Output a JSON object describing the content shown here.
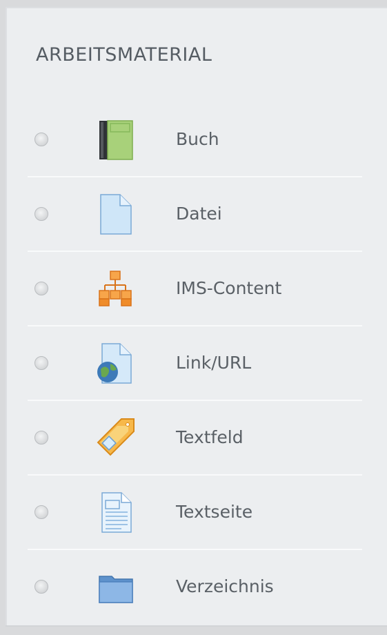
{
  "section": {
    "title": "ARBEITSMATERIAL"
  },
  "items": [
    {
      "label": "Buch",
      "icon": "book-icon"
    },
    {
      "label": "Datei",
      "icon": "file-icon"
    },
    {
      "label": "IMS-Content",
      "icon": "ims-content-icon"
    },
    {
      "label": "Link/URL",
      "icon": "url-icon"
    },
    {
      "label": "Textfeld",
      "icon": "label-tag-icon"
    },
    {
      "label": "Textseite",
      "icon": "page-icon"
    },
    {
      "label": "Verzeichnis",
      "icon": "folder-icon"
    }
  ]
}
